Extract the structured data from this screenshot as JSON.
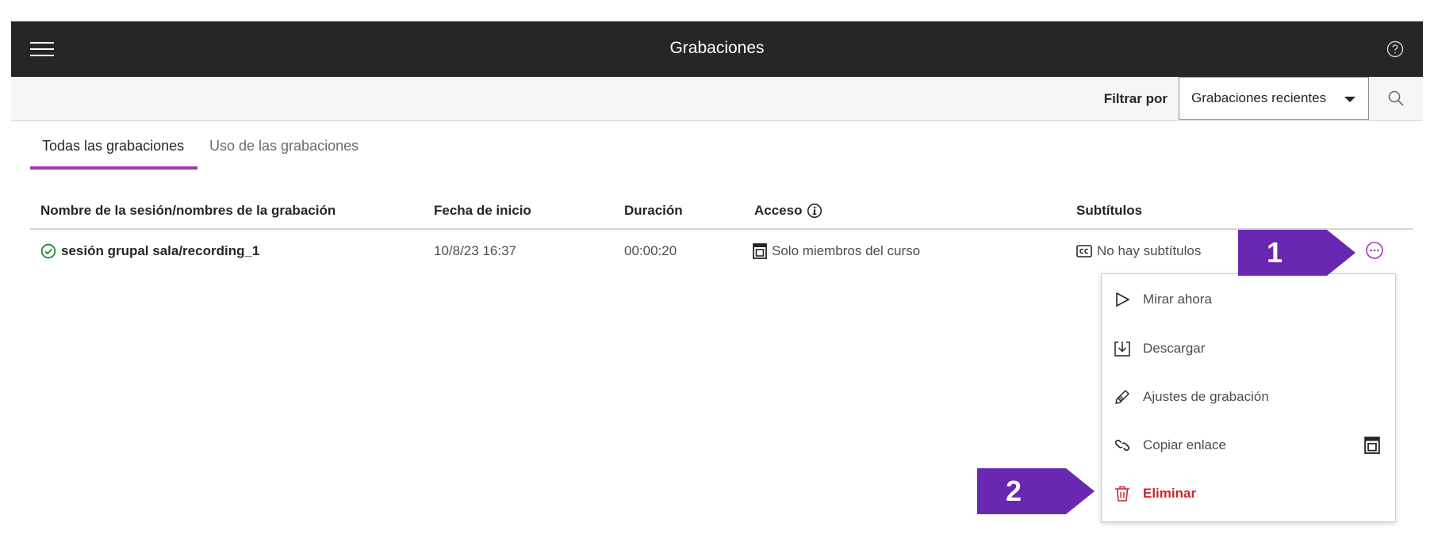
{
  "header": {
    "title": "Grabaciones"
  },
  "filter": {
    "label": "Filtrar por",
    "selected": "Grabaciones recientes"
  },
  "tabs": [
    {
      "label": "Todas las grabaciones",
      "active": true
    },
    {
      "label": "Uso de las grabaciones",
      "active": false
    }
  ],
  "table": {
    "columns": [
      "Nombre de la sesión/nombres de la grabación",
      "Fecha de inicio",
      "Duración",
      "Acceso",
      "Subtítulos"
    ],
    "rows": [
      {
        "name": "sesión grupal sala/recording_1",
        "start_date": "10/8/23 16:37",
        "duration": "00:00:20",
        "access": "Solo miembros del curso",
        "subtitles": "No hay subtítulos"
      }
    ]
  },
  "menu": {
    "items": [
      {
        "label": "Mirar ahora",
        "icon": "play-icon"
      },
      {
        "label": "Descargar",
        "icon": "download-icon"
      },
      {
        "label": "Ajustes de grabación",
        "icon": "pencil-icon"
      },
      {
        "label": "Copiar enlace",
        "icon": "link-icon"
      },
      {
        "label": "Eliminar",
        "icon": "trash-icon",
        "danger": true
      }
    ]
  },
  "callouts": {
    "first": "1",
    "second": "2"
  },
  "colors": {
    "header_bg": "#262626",
    "accent": "#a537b5",
    "callout": "#6a27b1",
    "danger": "#c7282f",
    "success": "#1a8a2b"
  }
}
